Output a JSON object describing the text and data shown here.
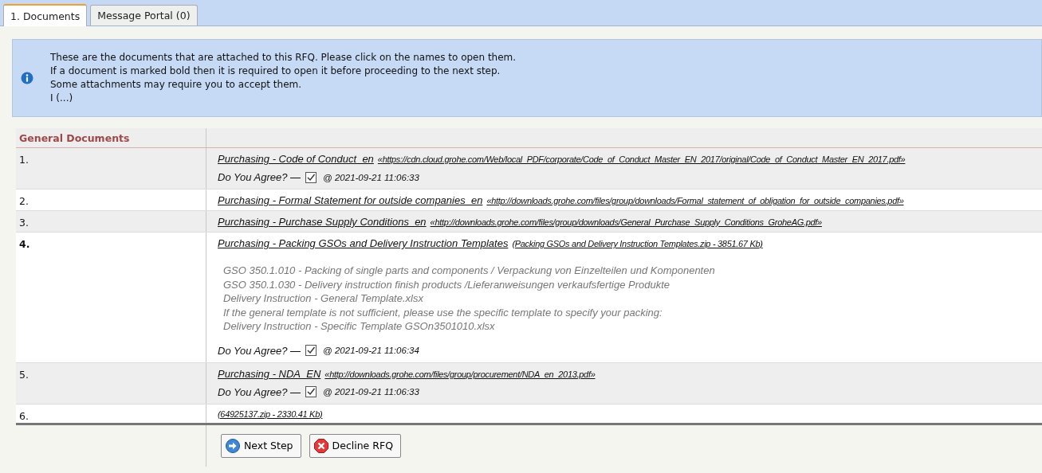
{
  "tabs": [
    {
      "label": "1. Documents",
      "selected": true
    },
    {
      "label": "Message Portal (0)",
      "selected": false
    }
  ],
  "info": {
    "lines": [
      "These are the documents that are attached to this RFQ. Please click on the names to open them.",
      "If a document is marked bold then it is required to open it before proceeding to the next step.",
      "Some attachments may require you to accept them.",
      "I (...)"
    ]
  },
  "table": {
    "heading": "General Documents",
    "rows": [
      {
        "number": "1.",
        "required": false,
        "title": "Purchasing - Code of Conduct_en",
        "link": "«https://cdn.cloud.grohe.com/Web/local_PDF/corporate/Code_of_Conduct_Master_EN_2017/original/Code_of_Conduct_Master_EN_2017.pdf»",
        "agree": {
          "label": "Do You Agree? —",
          "checked": true,
          "timestamp": "@ 2021-09-21 11:06:33"
        }
      },
      {
        "number": "2.",
        "required": false,
        "title": "Purchasing - Formal Statement for outside companies_en",
        "link": "«http://downloads.grohe.com/files/group/downloads/Formal_statement_of_obligation_for_outside_companies.pdf»"
      },
      {
        "number": "3.",
        "required": false,
        "title": "Purchasing - Purchase Supply Conditions_en",
        "link": "«http://downloads.grohe.com/files/group/downloads/General_Purchase_Supply_Conditions_GroheAG.pdf»"
      },
      {
        "number": "4.",
        "required": true,
        "title": "Purchasing - Packing GSOs and Delivery Instruction Templates",
        "link": "(Packing GSOs and Delivery Instruction Templates.zip - 3851.67 Kb)",
        "description": [
          "GSO 350.1.010 - Packing of single parts and components / Verpackung von Einzelteilen und Komponenten",
          "GSO 350.1.030 - Delivery instruction finish products /Lieferanweisungen verkaufsfertige Produkte",
          "Delivery Instruction - General Template.xlsx",
          "If the general template is not sufficient, please use the specific template to specify your packing:",
          "Delivery Instruction - Specific Template GSOn3501010.xlsx"
        ],
        "agree": {
          "label": "Do You Agree? —",
          "checked": true,
          "timestamp": "@ 2021-09-21 11:06:34"
        }
      },
      {
        "number": "5.",
        "required": false,
        "title": "Purchasing - NDA_EN",
        "link": "«http://downloads.grohe.com/files/group/procurement/NDA_en_2013.pdf»",
        "agree": {
          "label": "Do You Agree? —",
          "checked": true,
          "timestamp": "@ 2021-09-21 11:06:33"
        }
      },
      {
        "number": "6.",
        "required": false,
        "link": "(64925137.zip - 2330.41 Kb)"
      }
    ]
  },
  "buttons": [
    {
      "kind": "next",
      "label": "Next Step"
    },
    {
      "kind": "decline",
      "label": "Decline RFQ"
    }
  ]
}
